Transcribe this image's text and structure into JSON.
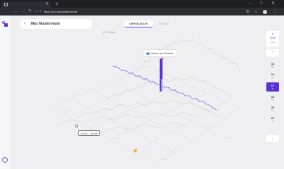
{
  "browser": {
    "tab_label": "",
    "url": "https://pro.sanapathealt.de",
    "colors": {
      "chrome": "#1f1f24",
      "toolbar": "#2c2c33"
    }
  },
  "header": {
    "back_icon": "chevron-left",
    "person_name": "Max Mustermann",
    "tabs": [
      {
        "label": "VERGLEICH",
        "active": true
      },
      {
        "label": "TREND",
        "active": false
      }
    ]
  },
  "chart": {
    "z_axis_label": "Ø: 4 Zähler",
    "tooltip_text": "Nutzer pro Stunde",
    "time_range": "11:00 – 12:00",
    "accent_color": "#6a3fe0"
  },
  "date_rail": {
    "month_num": "7",
    "month_label": "TAGE",
    "year": "2021",
    "days": [
      {
        "num": "13",
        "wd": "Mo",
        "active": false
      },
      {
        "num": "14",
        "wd": "Di",
        "active": false
      },
      {
        "num": "17",
        "wd": "Fr",
        "active": true
      },
      {
        "num": "18",
        "wd": "Sa",
        "active": false
      },
      {
        "num": "20",
        "wd": "Mo",
        "active": false
      },
      {
        "num": "21",
        "wd": "Di",
        "active": false
      }
    ]
  }
}
